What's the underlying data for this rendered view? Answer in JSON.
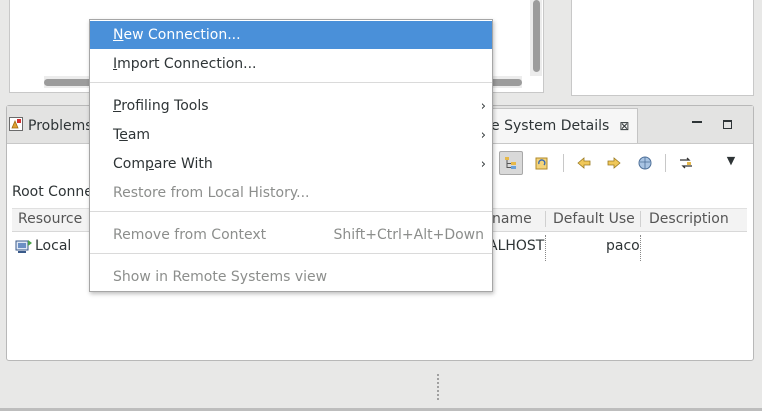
{
  "context_menu": {
    "items": [
      {
        "pre": "",
        "key": "N",
        "post": "ew Connection...",
        "state": "selected"
      },
      {
        "pre": "",
        "key": "I",
        "post": "mport Connection...",
        "state": "normal"
      },
      {
        "pre": "",
        "key": "P",
        "post": "rofiling Tools",
        "state": "normal",
        "submenu": true
      },
      {
        "pre": "T",
        "key": "e",
        "post": "am",
        "state": "normal",
        "submenu": true
      },
      {
        "pre": "Com",
        "key": "p",
        "post": "are With",
        "state": "normal",
        "submenu": true
      },
      {
        "pre": "Restore from Local History...",
        "key": "",
        "post": "",
        "state": "disabled"
      },
      {
        "pre": "Remove from Context",
        "key": "",
        "post": "",
        "state": "disabled",
        "accelerator": "Shift+Ctrl+Alt+Down"
      },
      {
        "pre": "Show in Remote Systems view",
        "key": "",
        "post": "",
        "state": "disabled"
      }
    ],
    "submenu_arrow": "›"
  },
  "tabs": {
    "problems_label": "Problems",
    "remote_label": "ote System Details",
    "close_glyph": "⊠"
  },
  "view": {
    "root_label": "Root Conne",
    "columns": {
      "resource": "Resource",
      "hostname": "name",
      "default_user": "Default User",
      "description": "Description"
    },
    "row": {
      "resource": "Local",
      "hostname": "ALHOST",
      "default_user": "paco"
    }
  },
  "toolbar": {
    "view_menu_glyph": "▼"
  },
  "colors": {
    "selection": "#4a90d9",
    "disabled_text": "#8c8e8c"
  }
}
